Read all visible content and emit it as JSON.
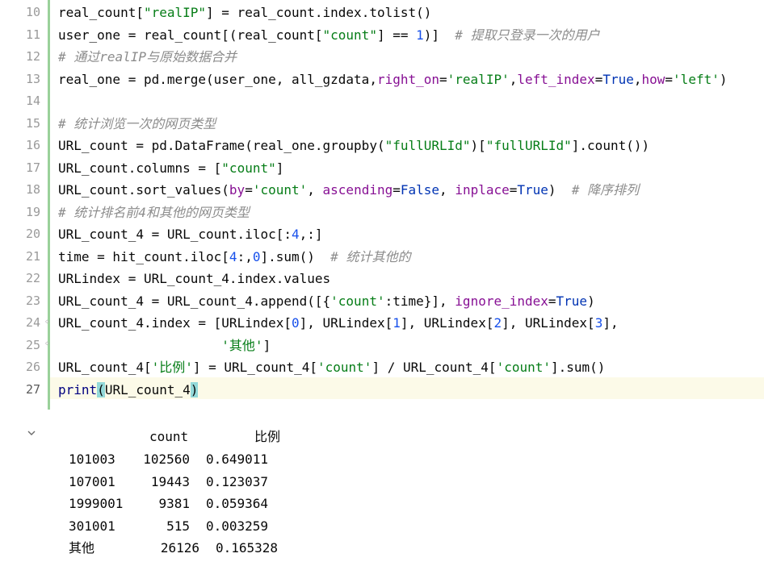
{
  "editor": {
    "line_numbers": [
      "10",
      "11",
      "12",
      "13",
      "14",
      "15",
      "16",
      "17",
      "18",
      "19",
      "20",
      "21",
      "22",
      "23",
      "24",
      "25",
      "26",
      "27"
    ],
    "lines": {
      "l10": {
        "p1": "real_count[",
        "s1": "\"realIP\"",
        "p2": "] = real_count.index.tolist()"
      },
      "l11": {
        "p1": "user_one = real_count[(real_count[",
        "s1": "\"count\"",
        "p2": "] == ",
        "n1": "1",
        "p3": ")]  ",
        "c1": "# 提取只登录一次的用户"
      },
      "l12": {
        "c1": "# 通过realIP与原始数据合并"
      },
      "l13": {
        "p1": "real_one = pd.merge(user_one, all_gzdata,",
        "k1": "right_on",
        "p2": "=",
        "s1": "'realIP'",
        "p3": ",",
        "k2": "left_index",
        "p4": "=",
        "b1": "True",
        "p5": ",",
        "k3": "how",
        "p6": "=",
        "s2": "'left'",
        "p7": ")"
      },
      "l15": {
        "c1": "# 统计浏览一次的网页类型"
      },
      "l16": {
        "p1": "URL_count = pd.DataFrame(real_one.groupby(",
        "s1": "\"fullURLId\"",
        "p2": ")[",
        "s2": "\"fullURLId\"",
        "p3": "].count())"
      },
      "l17": {
        "p1": "URL_count.columns = [",
        "s1": "\"count\"",
        "p2": "]"
      },
      "l18": {
        "p1": "URL_count.sort_values(",
        "k1": "by",
        "p2": "=",
        "s1": "'count'",
        "p3": ", ",
        "k2": "ascending",
        "p4": "=",
        "b1": "False",
        "p5": ", ",
        "k3": "inplace",
        "p6": "=",
        "b2": "True",
        "p7": ")  ",
        "c1": "# 降序排列"
      },
      "l19": {
        "c1": "# 统计排名前4和其他的网页类型"
      },
      "l20": {
        "p1": "URL_count_4 = URL_count.iloc[:",
        "n1": "4",
        "p2": ",:]"
      },
      "l21": {
        "p1": "time = hit_count.iloc[",
        "n1": "4",
        "p2": ":,",
        "n2": "0",
        "p3": "].sum()  ",
        "c1": "# 统计其他的"
      },
      "l22": {
        "p1": "URLindex = URL_count_4.index.values"
      },
      "l23": {
        "p1": "URL_count_4 = URL_count_4.append([{",
        "s1": "'count'",
        "p2": ":time}], ",
        "k1": "ignore_index",
        "p3": "=",
        "b1": "True",
        "p4": ")"
      },
      "l24": {
        "p1": "URL_count_4.index = [URLindex[",
        "n1": "0",
        "p2": "], URLindex[",
        "n2": "1",
        "p3": "], URLindex[",
        "n3": "2",
        "p4": "], URLindex[",
        "n4": "3",
        "p5": "],"
      },
      "l25": {
        "p1": "                     ",
        "s1": "'其他'",
        "p2": "]"
      },
      "l26": {
        "p1": "URL_count_4[",
        "s1": "'比例'",
        "p2": "] = URL_count_4[",
        "s2": "'count'",
        "p3": "] / URL_count_4[",
        "s3": "'count'",
        "p4": "].sum()"
      },
      "l27": {
        "f1": "print",
        "h1": "(",
        "p1": "URL_count_4",
        "h2": ")"
      }
    }
  },
  "output": {
    "headers": [
      "count",
      "比例"
    ],
    "rows": [
      {
        "index": "101003",
        "count": "102560",
        "ratio": "0.649011"
      },
      {
        "index": "107001",
        "count": "19443",
        "ratio": "0.123037"
      },
      {
        "index": "1999001",
        "count": "9381",
        "ratio": "0.059364"
      },
      {
        "index": "301001",
        "count": "515",
        "ratio": "0.003259"
      },
      {
        "index": "其他",
        "count": "26126",
        "ratio": "0.165328"
      }
    ]
  },
  "icons": {
    "collapse": "chevron-down-icon"
  },
  "colors": {
    "string": "#067d17",
    "keyword_arg": "#871094",
    "bool": "#0033b3",
    "number": "#1750eb",
    "comment": "#8c8c8c",
    "gutter_bar": "#9ad19a",
    "current_line": "#fcfae8",
    "paren_match": "#93d9d9"
  }
}
